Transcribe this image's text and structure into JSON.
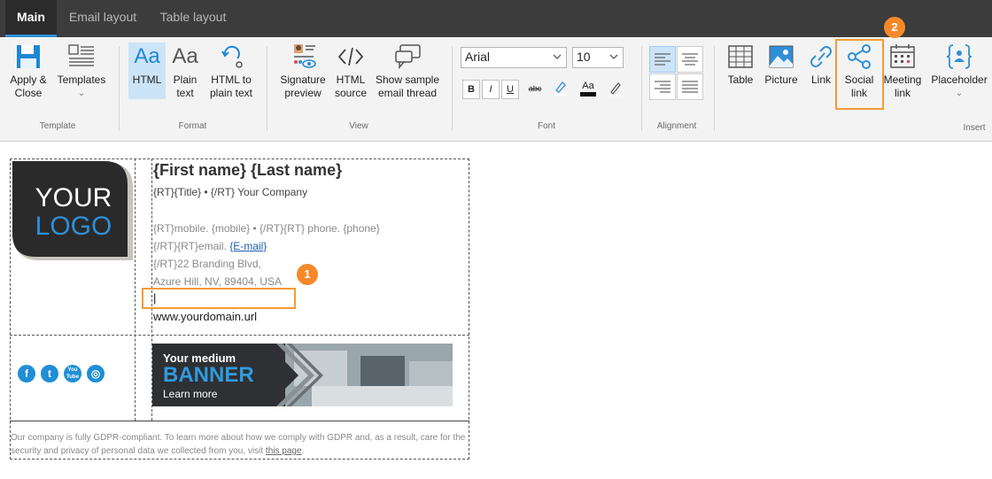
{
  "tabs": [
    {
      "label": "Main",
      "active": true
    },
    {
      "label": "Email layout",
      "active": false
    },
    {
      "label": "Table layout",
      "active": false
    }
  ],
  "ribbon": {
    "template": {
      "group_label": "Template",
      "apply_close": {
        "line1": "Apply &",
        "line2": "Close"
      },
      "templates": {
        "line1": "Templates",
        "line2": "⌄"
      }
    },
    "format": {
      "group_label": "Format",
      "html": {
        "line1": "HTML",
        "icon_text": "Aa"
      },
      "plain_text": {
        "line1": "Plain",
        "line2": "text",
        "icon_text": "Aa"
      },
      "html_to_plain": {
        "line1": "HTML to",
        "line2": "plain text"
      }
    },
    "view": {
      "group_label": "View",
      "signature_preview": {
        "line1": "Signature",
        "line2": "preview"
      },
      "html_source": {
        "line1": "HTML",
        "line2": "source"
      },
      "show_sample": {
        "line1": "Show sample",
        "line2": "email thread"
      }
    },
    "font": {
      "group_label": "Font",
      "family": "Arial",
      "size": "10",
      "bold": "B",
      "italic": "I",
      "underline": "U",
      "strike": "abc",
      "font_color_text": "Aa"
    },
    "alignment": {
      "group_label": "Alignment"
    },
    "insert": {
      "group_label": "Insert",
      "table": {
        "line1": "Table"
      },
      "picture": {
        "line1": "Picture"
      },
      "link": {
        "line1": "Link"
      },
      "social_link": {
        "line1": "Social",
        "line2": "link"
      },
      "meeting_link": {
        "line1": "Meeting",
        "line2": "link"
      },
      "placeholder": {
        "line1": "Placeholder",
        "line2": "⌄"
      }
    }
  },
  "callouts": {
    "one": "1",
    "two": "2"
  },
  "signature": {
    "logo": {
      "line1": "YOUR",
      "line2": "LOGO"
    },
    "name": "{First name} {Last name}",
    "title_line": "{RT}{Title} • {/RT} Your Company",
    "mobile_line": "{RT}mobile. {mobile} • {/RT}{RT} phone. {phone}",
    "email_prefix": "{/RT}{RT}email. ",
    "email_link": "{E-mail}",
    "address1": "{/RT}22 Branding Blvd,",
    "address2": "Azure Hill, NV, 89404, USA",
    "cursor": "|",
    "website": "www.yourdomain.url",
    "social_icons": [
      {
        "name": "facebook-icon",
        "glyph": "f"
      },
      {
        "name": "twitter-icon",
        "glyph": "t"
      },
      {
        "name": "youtube-icon",
        "glyph": "You\nTube"
      },
      {
        "name": "instagram-icon",
        "glyph": "◎"
      }
    ],
    "banner": {
      "line1": "Your medium",
      "line2": "BANNER",
      "cta": "Learn more"
    },
    "disclaimer_text": "Our company is fully GDPR-compliant. To learn more about how we comply with GDPR and, as a result, care for the security and privacy of personal data we collected from you, visit ",
    "disclaimer_link": "this page",
    "disclaimer_end": "."
  },
  "colors": {
    "accent": "#2f8fd8",
    "callout": "#f5892a",
    "tabbar": "#3c3c3c",
    "ribbon": "#f3f3f3"
  }
}
